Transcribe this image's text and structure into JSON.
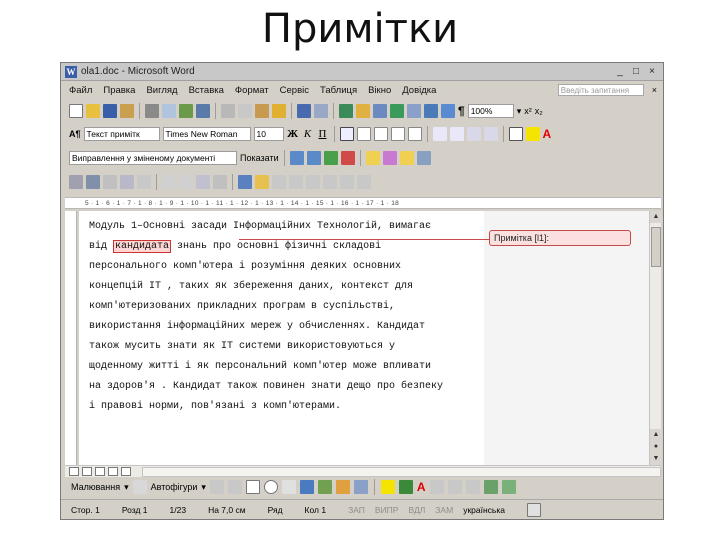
{
  "slide": {
    "title": "Примітки"
  },
  "window": {
    "title": "ola1.doc - Microsoft Word",
    "app_icon": "W",
    "controls": [
      "_",
      "□",
      "×"
    ]
  },
  "menu": {
    "items": [
      "Файл",
      "Правка",
      "Вигляд",
      "Вставка",
      "Формат",
      "Сервіс",
      "Таблиця",
      "Вікно",
      "Довідка"
    ],
    "help_placeholder": "Введіть запитання",
    "close": "×"
  },
  "toolbar_standard": {
    "zoom": "100%",
    "icons": [
      "new-icon",
      "open-icon",
      "save-icon",
      "permission-icon",
      "print-icon",
      "print-preview-icon",
      "spelling-icon",
      "research-icon",
      "cut-icon",
      "copy-icon",
      "paste-icon",
      "format-painter-icon",
      "undo-icon",
      "redo-icon",
      "hyperlink-icon",
      "tables-borders-icon",
      "insert-table-icon",
      "insert-excel-icon",
      "columns-icon",
      "drawing-icon",
      "document-map-icon",
      "show-hide-icon"
    ],
    "pilcrow": "¶",
    "superscript": "x²",
    "subscript": "x₂"
  },
  "toolbar_formatting": {
    "style": "Текст примітк",
    "font": "Times New Roman",
    "size": "10",
    "bold": "Ж",
    "italic": "К",
    "underline": "П"
  },
  "toolbar_reviewing": {
    "track_mode": "Виправлення у зміненому документі",
    "show_label": "Показати"
  },
  "ruler": {
    "text": "5 · 1 · 6 · 1 · 7 · 1 · 8 · 1 · 9 · 1 · 10 · 1 · 11 · 1 · 12 · 1 · 13 · 1 · 14 · 1 · 15 · 1 · 16 · 1 · 17 · 1 · 18"
  },
  "document": {
    "before_highlight": "Модуль 1–Основні засади Інформаційних Технологій, вимагає від ",
    "highlighted": "кандидата",
    "after_highlight": " знань про основні фізичні складові персонального комп'ютера і розуміння деяких основних концепцій ІТ , таких як збереження даних, контекст для комп'ютеризованих прикладних програм в суспільстві, використання інформаційних мереж у обчисленнях. Кандидат також мусить знати як ІТ системи використовуються у щоденному житті і як персональний комп'ютер може впливати на здоров'я . Кандидат також повинен знати дещо про безпеку і правові норми, пов'язані з комп'ютерами.",
    "comment": "Примітка [l1]:"
  },
  "draw_toolbar": {
    "draw": "Малювання",
    "autoshapes": "Автофігури"
  },
  "status": {
    "page": "Стор. 1",
    "section": "Розд 1",
    "pages": "1/23",
    "at": "На 7,0 см",
    "line": "Ряд",
    "col": "Кол 1",
    "modes": [
      "ЗАП",
      "ВИПР",
      "ВДЛ",
      "ЗАМ"
    ],
    "language": "українська"
  },
  "colors": {
    "accent_red": "#c64a4a",
    "highlight_yellow": "#f4e400",
    "font_red": "#e00000"
  }
}
